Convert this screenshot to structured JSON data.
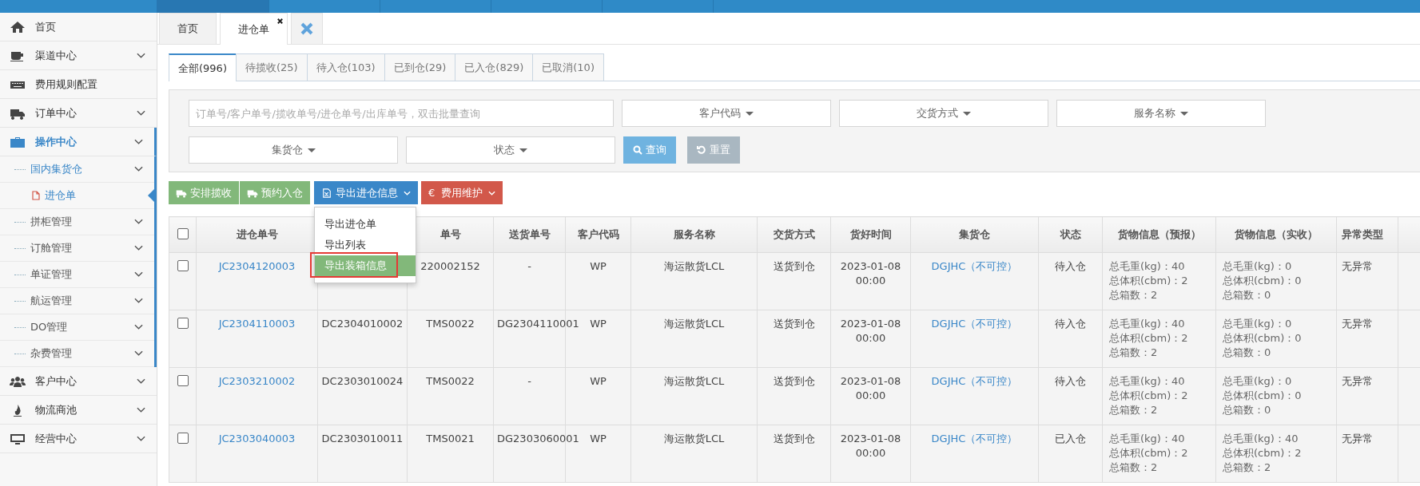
{
  "sidebar": {
    "items": [
      {
        "label": "首页",
        "expandable": false,
        "selected": false
      },
      {
        "label": "渠道中心",
        "expandable": true,
        "expanded": false,
        "selected": false
      },
      {
        "label": "费用规则配置",
        "expandable": false,
        "selected": false
      },
      {
        "label": "订单中心",
        "expandable": true,
        "expanded": false,
        "selected": false
      },
      {
        "label": "操作中心",
        "expandable": true,
        "expanded": true,
        "selected": true,
        "children": [
          {
            "label": "国内集货仓",
            "expandable": true,
            "expanded": true,
            "selected": false,
            "children": [
              {
                "label": "进仓单",
                "selected": true
              }
            ]
          },
          {
            "label": "拼柜管理",
            "expandable": true,
            "expanded": false,
            "selected": false
          },
          {
            "label": "订舱管理",
            "expandable": true,
            "expanded": false,
            "selected": false
          },
          {
            "label": "单证管理",
            "expandable": true,
            "expanded": false,
            "selected": false
          },
          {
            "label": "航运管理",
            "expandable": true,
            "expanded": false,
            "selected": false
          },
          {
            "label": "DO管理",
            "expandable": true,
            "expanded": false,
            "selected": false
          },
          {
            "label": "杂费管理",
            "expandable": true,
            "expanded": false,
            "selected": false
          }
        ]
      },
      {
        "label": "客户中心",
        "expandable": true,
        "expanded": false,
        "selected": false
      },
      {
        "label": "物流商池",
        "expandable": true,
        "expanded": false,
        "selected": false
      },
      {
        "label": "经营中心",
        "expandable": true,
        "expanded": false,
        "selected": false
      }
    ]
  },
  "page_tabs": [
    {
      "label": "首页",
      "selected": false,
      "closable": false
    },
    {
      "label": "进仓单",
      "selected": true,
      "closable": true
    }
  ],
  "status_tabs": [
    {
      "label": "全部(996)",
      "selected": true
    },
    {
      "label": "待揽收(25)",
      "selected": false
    },
    {
      "label": "待入仓(103)",
      "selected": false
    },
    {
      "label": "已到仓(29)",
      "selected": false
    },
    {
      "label": "已入仓(829)",
      "selected": false
    },
    {
      "label": "已取消(10)",
      "selected": false
    }
  ],
  "filters": {
    "search": {
      "placeholder": "订单号/客户单号/揽收单号/进仓单号/出库单号，双击批量查询"
    },
    "dropdowns": [
      "客户代码",
      "交货方式",
      "服务名称",
      "集货仓",
      "状态"
    ],
    "query_button": "查询",
    "reset_button": "重置"
  },
  "actions": [
    {
      "label": "安排揽收",
      "color": "#82b87a",
      "kind": "truck",
      "dropdown": false
    },
    {
      "label": "预约入仓",
      "color": "#82b87a",
      "kind": "truck",
      "dropdown": false
    },
    {
      "label": "导出进仓信息",
      "color": "#3a87c8",
      "kind": "file",
      "dropdown": true
    },
    {
      "label": "费用维护",
      "color": "#d2584a",
      "kind": "euro",
      "symbol": "€",
      "dropdown": true
    }
  ],
  "export_menu": {
    "items": [
      {
        "label": "导出进仓单",
        "selected": false
      },
      {
        "label": "导出列表",
        "selected": false
      },
      {
        "label": "导出装箱信息",
        "selected": true
      }
    ]
  },
  "table": {
    "header_checked": false,
    "columns": [
      {
        "label": "进仓单号",
        "kind": "link"
      },
      {
        "kind": "text"
      },
      {
        "label": "单号",
        "kind": "text"
      },
      {
        "label": "送货单号",
        "kind": "text"
      },
      {
        "label": "客户代码",
        "kind": "text"
      },
      {
        "label": "服务名称",
        "kind": "text"
      },
      {
        "label": "交货方式",
        "kind": "text"
      },
      {
        "label": "货好时间",
        "kind": "text"
      },
      {
        "label": "集货仓",
        "kind": "link"
      },
      {
        "label": "状态",
        "kind": "text"
      },
      {
        "label": "货物信息（预报）",
        "kind": "lines"
      },
      {
        "label": "货物信息（实收）",
        "kind": "lines"
      },
      {
        "label": "异常类型",
        "kind": "left"
      }
    ],
    "rows": [
      {
        "checked": false,
        "cells": [
          [
            "JC2304120003"
          ],
          [],
          [
            "220002152"
          ],
          [
            "-"
          ],
          [
            "WP"
          ],
          [
            "海运散货LCL"
          ],
          [
            "送货到仓"
          ],
          [
            "2023-01-08",
            "00:00"
          ],
          [
            "DGJHC（不可控）"
          ],
          [
            "待入仓"
          ],
          [
            "总毛重(kg)：40",
            "总体积(cbm)：2",
            "总箱数：2"
          ],
          [
            "总毛重(kg)：0",
            "总体积(cbm)：0",
            "总箱数：0"
          ],
          [
            "无异常"
          ]
        ]
      },
      {
        "checked": false,
        "cells": [
          [
            "JC2304110003"
          ],
          [
            "DC2304010002"
          ],
          [
            "TMS0022"
          ],
          [
            "DG2304110001"
          ],
          [
            "WP"
          ],
          [
            "海运散货LCL"
          ],
          [
            "送货到仓"
          ],
          [
            "2023-01-08",
            "00:00"
          ],
          [
            "DGJHC（不可控）"
          ],
          [
            "待入仓"
          ],
          [
            "总毛重(kg)：40",
            "总体积(cbm)：2",
            "总箱数：2"
          ],
          [
            "总毛重(kg)：0",
            "总体积(cbm)：0",
            "总箱数：0"
          ],
          [
            "无异常"
          ]
        ]
      },
      {
        "checked": false,
        "cells": [
          [
            "JC2303210002"
          ],
          [
            "DC2303010024"
          ],
          [
            "TMS0022"
          ],
          [
            "-"
          ],
          [
            "WP"
          ],
          [
            "海运散货LCL"
          ],
          [
            "送货到仓"
          ],
          [
            "2023-01-08",
            "00:00"
          ],
          [
            "DGJHC（不可控）"
          ],
          [
            "待入仓"
          ],
          [
            "总毛重(kg)：40",
            "总体积(cbm)：2",
            "总箱数：2"
          ],
          [
            "总毛重(kg)：0",
            "总体积(cbm)：0",
            "总箱数：0"
          ],
          [
            "无异常"
          ]
        ]
      },
      {
        "checked": false,
        "cells": [
          [
            "JC2303040003"
          ],
          [
            "DC2303010011"
          ],
          [
            "TMS0021"
          ],
          [
            "DG2303060001"
          ],
          [
            "WP"
          ],
          [
            "海运散货LCL"
          ],
          [
            "送货到仓"
          ],
          [
            "2023-01-08",
            "00:00"
          ],
          [
            "DGJHC（不可控）"
          ],
          [
            "已入仓"
          ],
          [
            "总毛重(kg)：40",
            "总体积(cbm)：2",
            "总箱数：2"
          ],
          [
            "总毛重(kg)：40",
            "总体积(cbm)：2",
            "总箱数：2"
          ],
          [
            "无异常"
          ]
        ]
      }
    ]
  }
}
